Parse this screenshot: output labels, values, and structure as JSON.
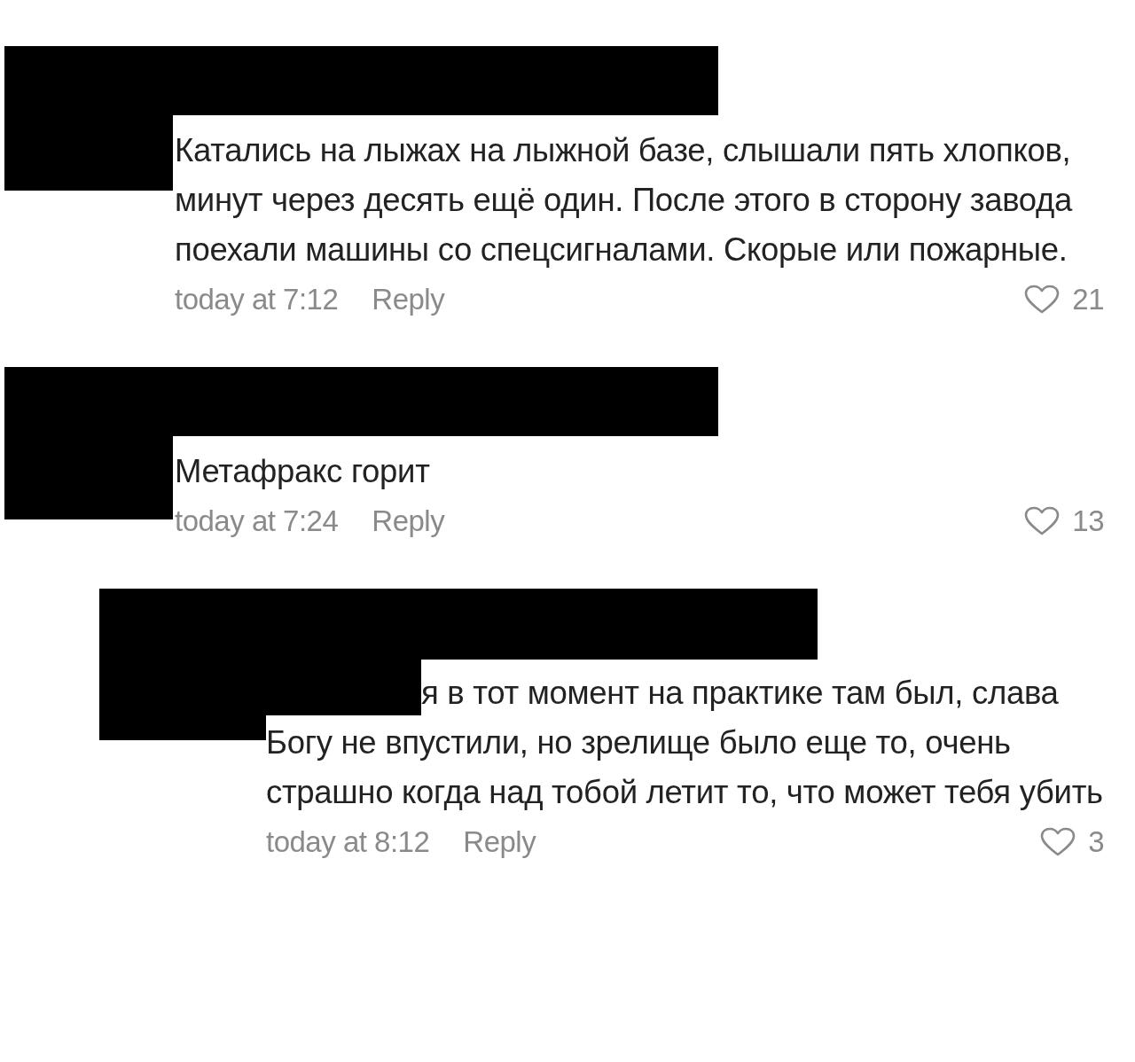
{
  "comments": [
    {
      "kind": "comment",
      "redacted": true,
      "text": "Катались на лыжах на лыжной базе, слышали пять хлопков, минут через десять ещё один. После этого в сторону завода поехали машины со спецсигналами. Скорые или пожарные.",
      "time": "today at 7:12",
      "reply": "Reply",
      "likes": "21"
    },
    {
      "kind": "comment",
      "redacted": true,
      "text": "Метафракс горит",
      "time": "today at 7:24",
      "reply": "Reply",
      "likes": "13"
    },
    {
      "kind": "reply",
      "redacted": true,
      "text": "я в тот момент на практике там был, слава Богу не впустили, но зрелище было еще то, очень страшно когда над тобой летит то, что может тебя убить",
      "time": "today at 8:12",
      "reply": "Reply",
      "likes": "3"
    }
  ]
}
